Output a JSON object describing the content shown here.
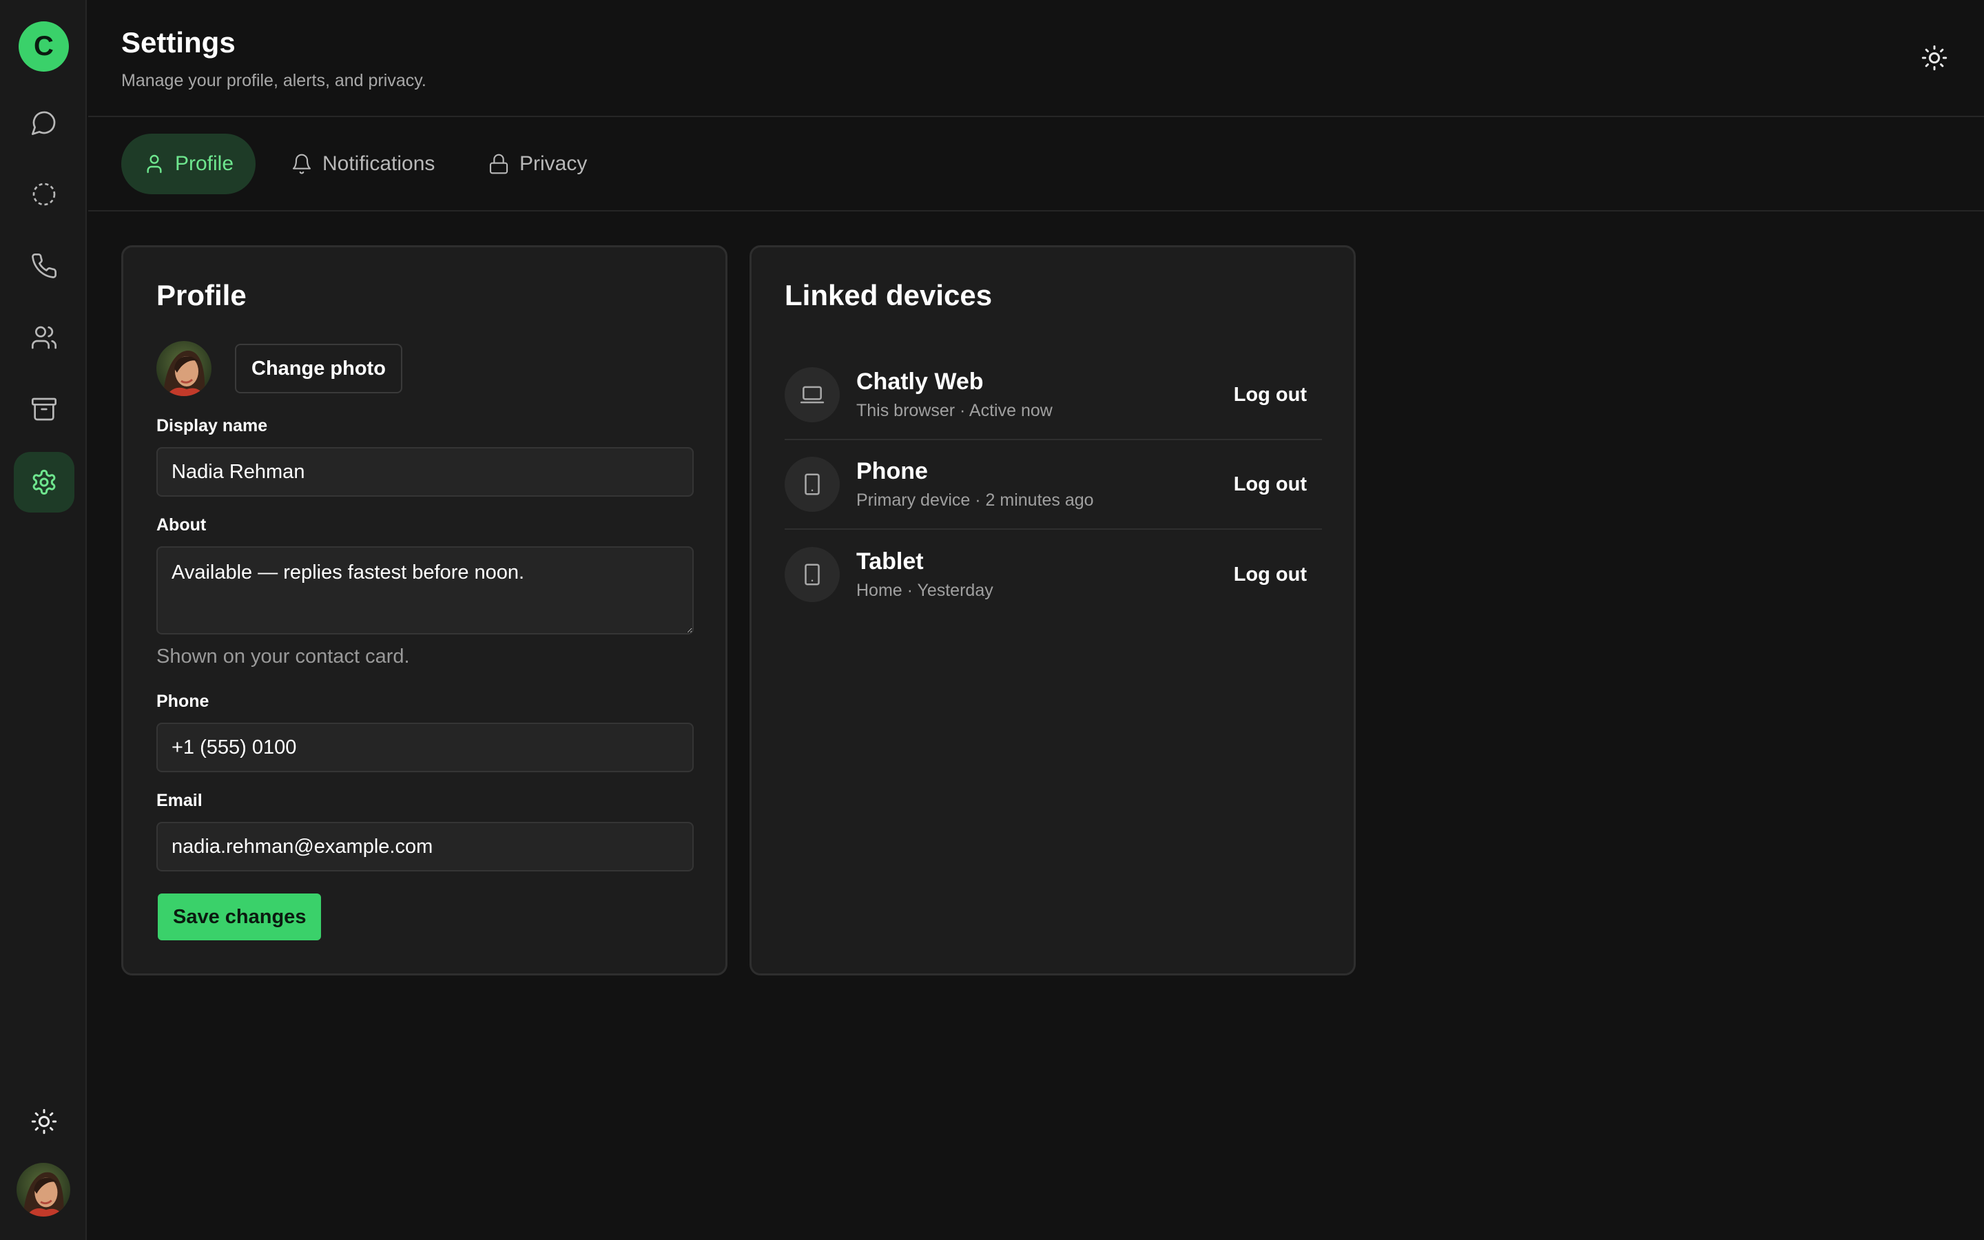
{
  "app": {
    "logo_letter": "C"
  },
  "rail": {
    "items": [
      {
        "name": "chats",
        "icon": "chat-bubble-icon"
      },
      {
        "name": "status",
        "icon": "status-ring-icon"
      },
      {
        "name": "calls",
        "icon": "phone-icon"
      },
      {
        "name": "contacts",
        "icon": "users-icon"
      },
      {
        "name": "archive",
        "icon": "archive-icon"
      },
      {
        "name": "settings",
        "icon": "gear-icon",
        "active": true
      }
    ],
    "bottom": [
      {
        "name": "theme",
        "icon": "sun-icon"
      },
      {
        "name": "profile-avatar",
        "icon": "avatar"
      }
    ]
  },
  "header": {
    "title": "Settings",
    "subtitle": "Manage your profile, alerts, and privacy."
  },
  "tabs": [
    {
      "label": "Profile",
      "icon": "user-icon",
      "active": true
    },
    {
      "label": "Notifications",
      "icon": "bell-icon",
      "active": false
    },
    {
      "label": "Privacy",
      "icon": "lock-icon",
      "active": false
    }
  ],
  "profile": {
    "title": "Profile",
    "change_photo": "Change photo",
    "display_name_label": "Display name",
    "display_name_value": "Nadia Rehman",
    "about_label": "About",
    "about_value": "Available — replies fastest before noon.",
    "about_hint": "Shown on your contact card.",
    "phone_label": "Phone",
    "phone_value": "+1 (555) 0100",
    "email_label": "Email",
    "email_value": "nadia.rehman@example.com",
    "save_label": "Save changes"
  },
  "devices": {
    "title": "Linked devices",
    "items": [
      {
        "name": "Chatly Web",
        "meta": "This browser · Active now",
        "icon": "laptop-icon",
        "action": "Log out"
      },
      {
        "name": "Phone",
        "meta": "Primary device · 2 minutes ago",
        "icon": "tablet-icon",
        "action": "Log out"
      },
      {
        "name": "Tablet",
        "meta": "Home · Yesterday",
        "icon": "tablet-icon",
        "action": "Log out"
      }
    ]
  },
  "colors": {
    "accent": "#3ad16a",
    "accent_bg": "#1e3b27",
    "background": "#121212",
    "card": "#1d1d1d"
  }
}
